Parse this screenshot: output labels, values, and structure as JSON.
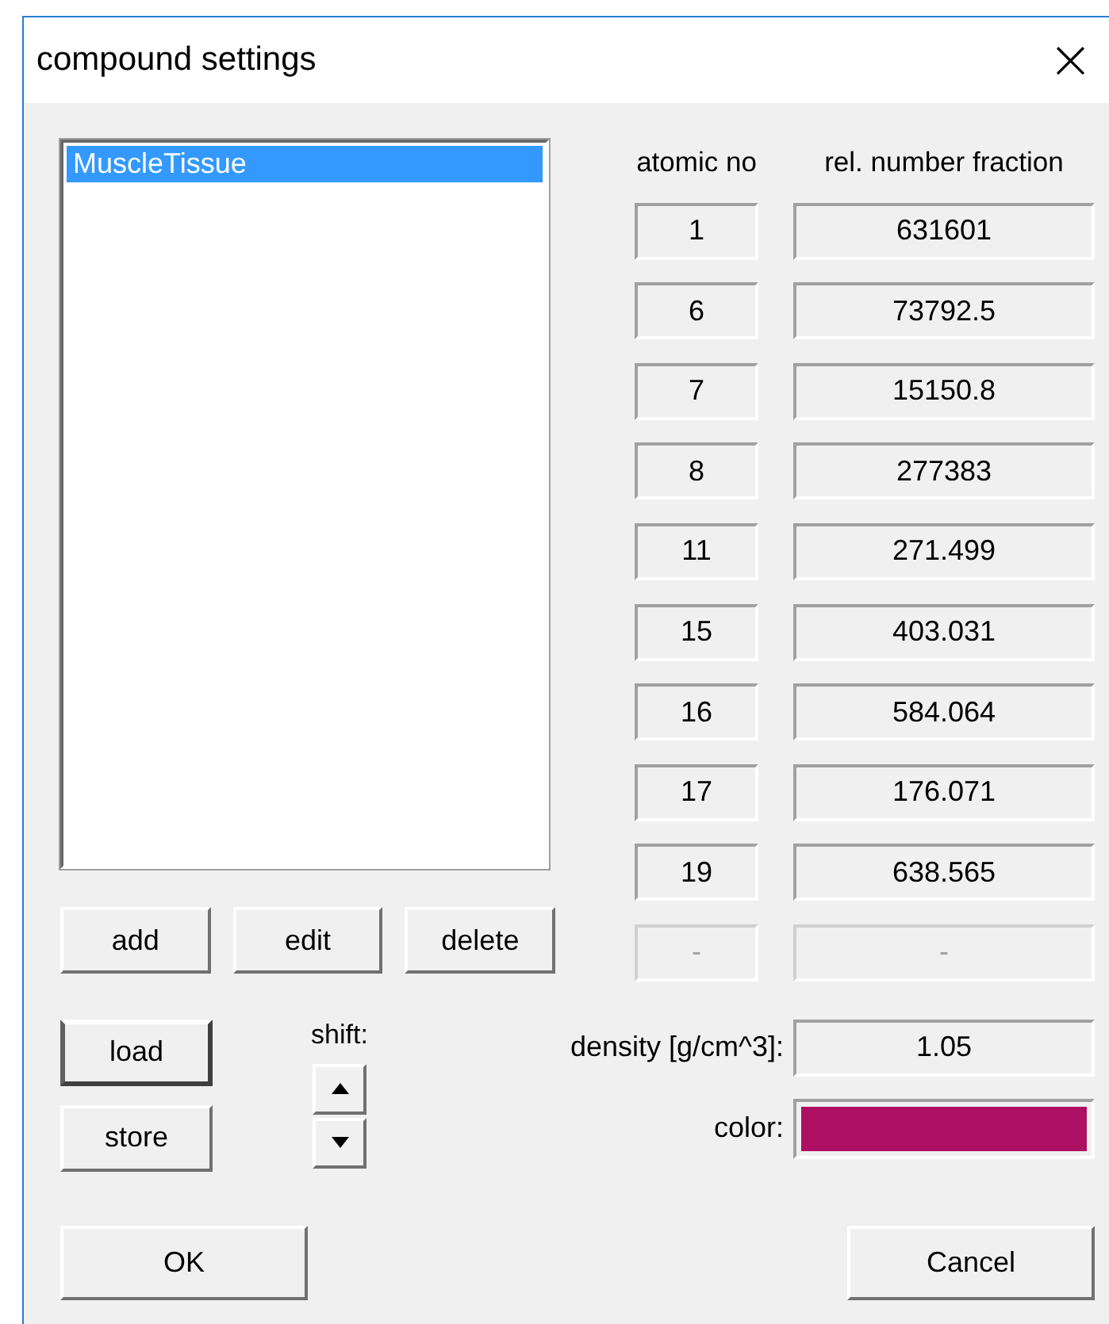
{
  "window": {
    "title": "compound settings",
    "close": "×"
  },
  "compounds": [
    {
      "label": "MuscleTissue",
      "selected": true
    }
  ],
  "list_buttons": [
    "add",
    "edit",
    "delete"
  ],
  "table": {
    "columns": [
      "atomic no",
      "rel. number fraction"
    ],
    "rows": [
      {
        "atomic_no": "1",
        "fraction": "631601",
        "disabled": false
      },
      {
        "atomic_no": "6",
        "fraction": "73792.5",
        "disabled": false
      },
      {
        "atomic_no": "7",
        "fraction": "15150.8",
        "disabled": false
      },
      {
        "atomic_no": "8",
        "fraction": "277383",
        "disabled": false
      },
      {
        "atomic_no": "11",
        "fraction": "271.499",
        "disabled": false
      },
      {
        "atomic_no": "15",
        "fraction": "403.031",
        "disabled": false
      },
      {
        "atomic_no": "16",
        "fraction": "584.064",
        "disabled": false
      },
      {
        "atomic_no": "17",
        "fraction": "176.071",
        "disabled": false
      },
      {
        "atomic_no": "19",
        "fraction": "638.565",
        "disabled": false
      },
      {
        "atomic_no": "-",
        "fraction": "-",
        "disabled": true
      }
    ]
  },
  "file_buttons": [
    {
      "label": "load",
      "focused": true
    },
    {
      "label": "store",
      "focused": false
    }
  ],
  "shift": {
    "label": "shift:"
  },
  "density": {
    "label": "density [g/cm^3]:",
    "value": "1.05"
  },
  "color": {
    "label": "color:",
    "color": "#ad0f63"
  },
  "dialog_buttons": [
    "OK",
    "Cancel"
  ]
}
